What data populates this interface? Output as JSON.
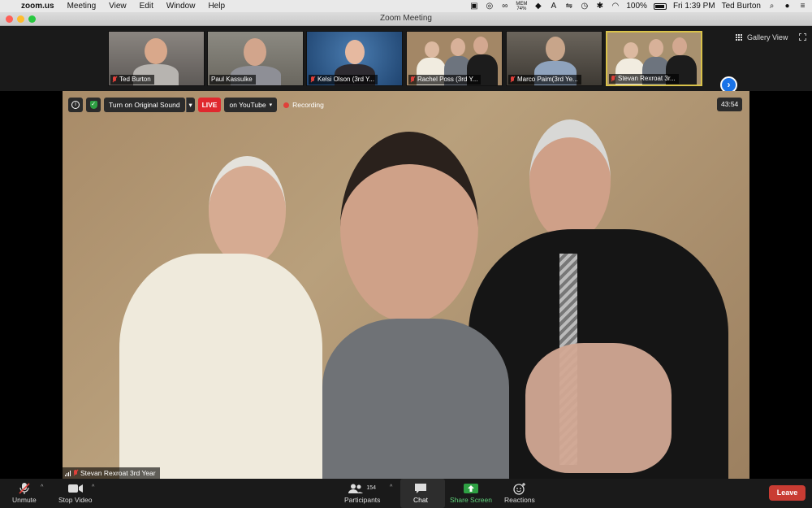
{
  "menubar": {
    "app_name": "zoom.us",
    "menus": [
      "Meeting",
      "View",
      "Edit",
      "Window",
      "Help"
    ],
    "memory_label": "MEM",
    "memory_value": "74%",
    "battery": "100%",
    "clock": "Fri 1:39 PM",
    "user": "Ted Burton"
  },
  "window": {
    "title": "Zoom Meeting"
  },
  "filmstrip": {
    "participants": [
      {
        "name": "Ted Burton",
        "bg": "#6f6a66"
      },
      {
        "name": "Paul Kassulke",
        "bg": "#7c7a72"
      },
      {
        "name": "Kelsi Olson (3rd Y...",
        "bg": "#2f5d8c"
      },
      {
        "name": "Rachel Poss (3rd Y...",
        "bg": "#a38766"
      },
      {
        "name": "Marco Paim(3rd Ye...",
        "bg": "#4e4a44"
      },
      {
        "name": "Stevan Rexroat 3r...",
        "bg": "#a8916f"
      }
    ],
    "gallery_view_label": "Gallery View",
    "next_arrow": "›"
  },
  "overlay": {
    "sound_button": "Turn on Original Sound",
    "live_label": "LIVE",
    "live_platform": "on YouTube",
    "recording_label": "Recording",
    "timer": "43:54",
    "active_speaker": "Stevan Rexroat 3rd Year"
  },
  "toolbar": {
    "unmute": "Unmute",
    "stop_video": "Stop Video",
    "participants": "Participants",
    "participant_count": "154",
    "chat": "Chat",
    "share_screen": "Share Screen",
    "reactions": "Reactions",
    "leave": "Leave"
  },
  "colors": {
    "share_green": "#2ea043",
    "leave_red": "#c93c33",
    "live_red": "#e0282e",
    "active_border": "#d9c24a",
    "next_blue": "#1a73e8"
  }
}
